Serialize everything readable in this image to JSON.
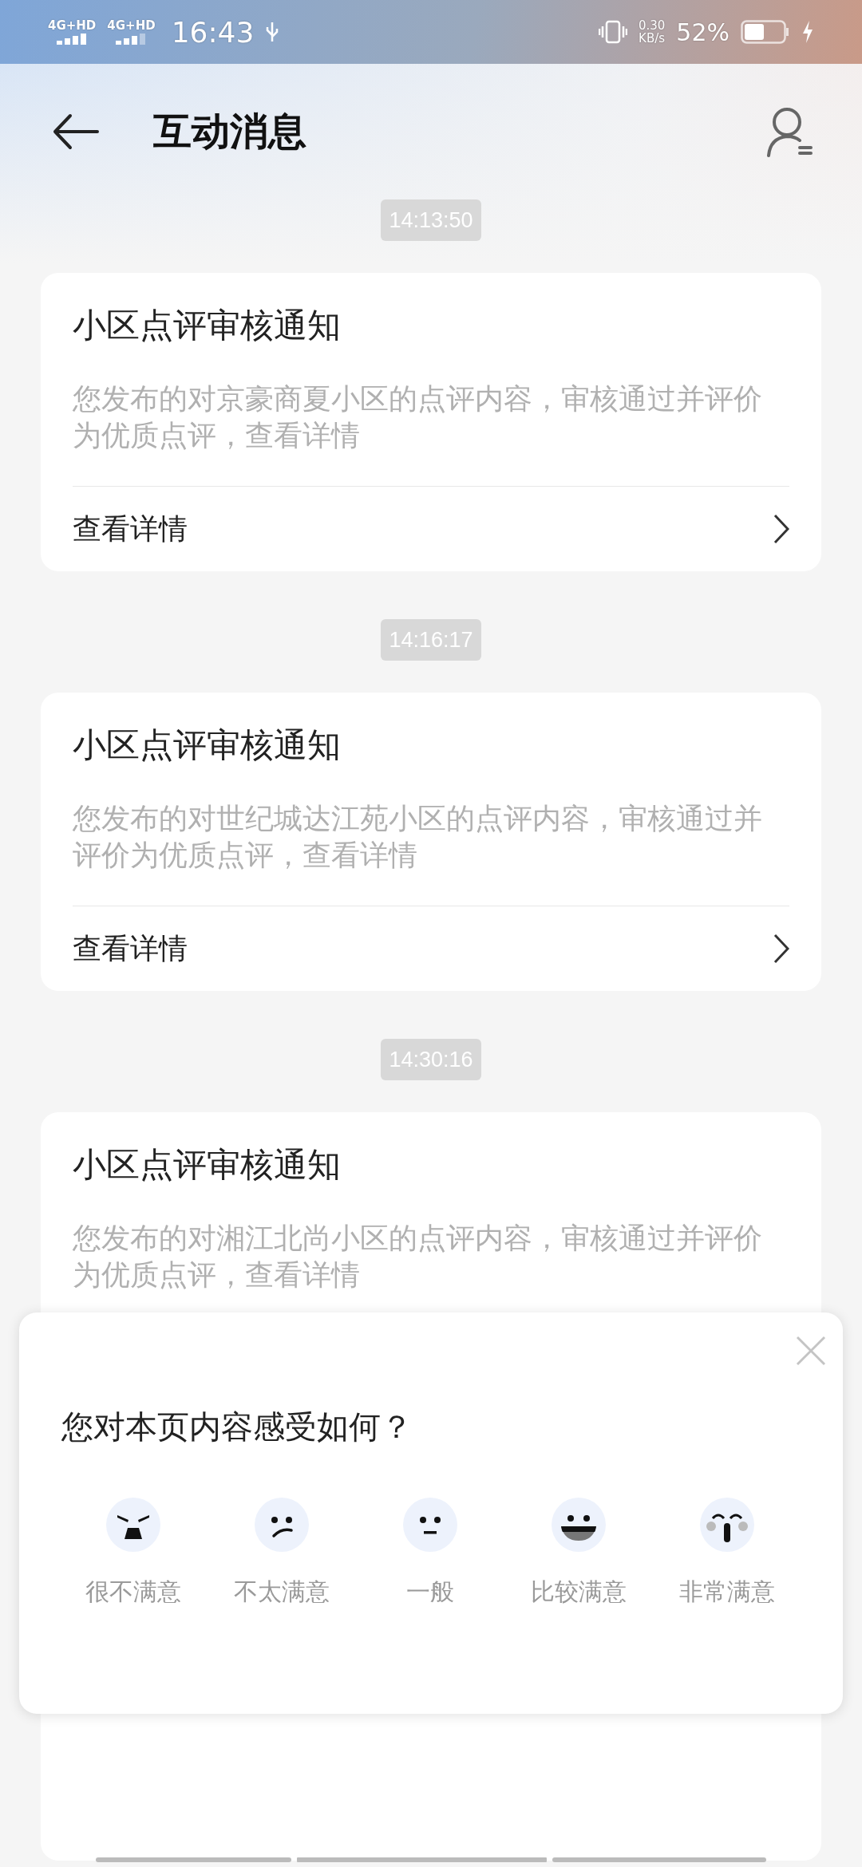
{
  "status_bar": {
    "signal_labels": [
      "4G+HD",
      "4G+HD"
    ],
    "time": "16:43",
    "speed_value": "0.30",
    "speed_unit": "KB/s",
    "battery": "52%"
  },
  "header": {
    "title": "互动消息"
  },
  "messages": [
    {
      "time": "14:13:50",
      "title": "小区点评审核通知",
      "body": "您发布的对京豪商夏小区的点评内容，审核通过并评价为优质点评，查看详情",
      "link": "查看详情"
    },
    {
      "time": "14:16:17",
      "title": "小区点评审核通知",
      "body": "您发布的对世纪城达江苑小区的点评内容，审核通过并评价为优质点评，查看详情",
      "link": "查看详情"
    },
    {
      "time": "14:30:16",
      "title": "小区点评审核通知",
      "body": "您发布的对湘江北尚小区的点评内容，审核通过并评价为优质点评，查看详情"
    }
  ],
  "feedback": {
    "question": "您对本页内容感受如何？",
    "options": [
      {
        "kind": "angry",
        "label": "很不满意"
      },
      {
        "kind": "unhappy",
        "label": "不太满意"
      },
      {
        "kind": "neutral",
        "label": "一般"
      },
      {
        "kind": "happy",
        "label": "比较满意"
      },
      {
        "kind": "amazed",
        "label": "非常满意"
      }
    ]
  }
}
